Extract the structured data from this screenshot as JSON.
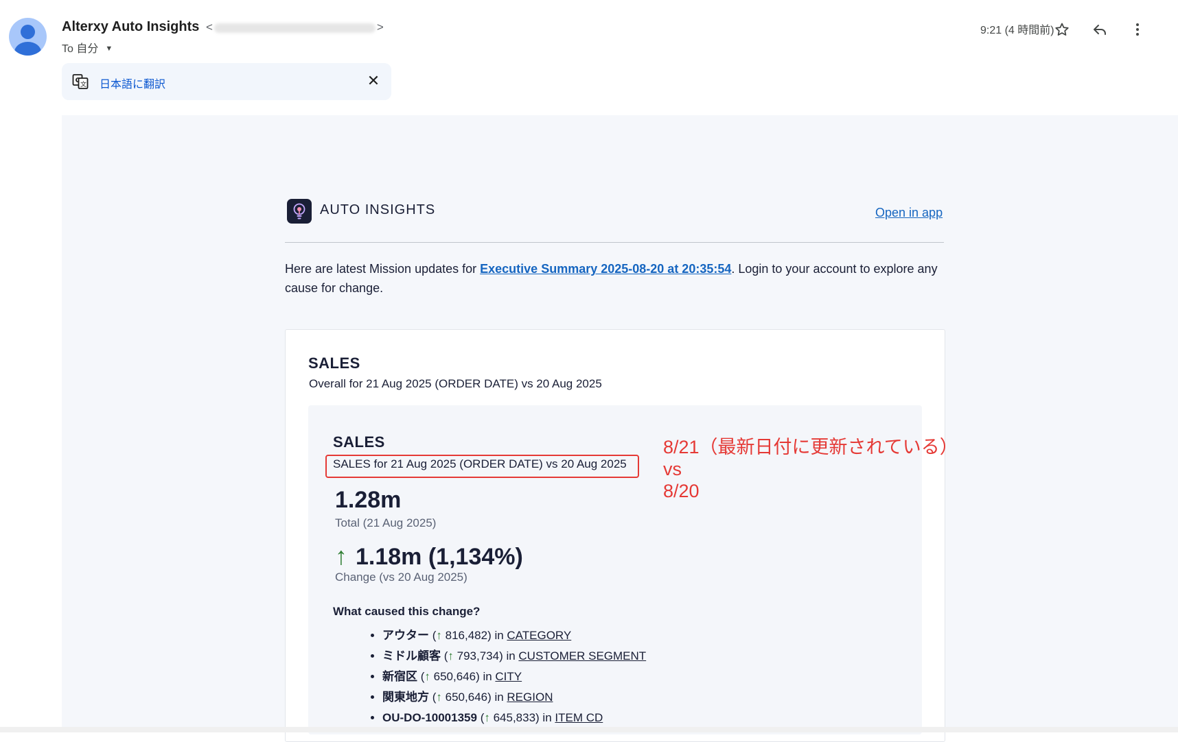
{
  "header": {
    "sender_name": "Alterxy Auto Insights",
    "sender_email_open": "<",
    "sender_email_close": ">",
    "to_label": "To 自分",
    "time": "9:21 (4 時間前)"
  },
  "translate_bar": {
    "link_label": "日本語に翻訳"
  },
  "email": {
    "brand": "AUTO INSIGHTS",
    "open_in_app": "Open in app",
    "intro_before": "Here are latest Mission updates for ",
    "intro_link": "Executive Summary 2025-08-20 at 20:35:54",
    "intro_after": ". Login to your account to explore any cause for change.",
    "card": {
      "title": "SALES",
      "subtitle": "Overall for 21 Aug 2025 (ORDER DATE) vs 20 Aug 2025",
      "inner": {
        "title": "SALES",
        "subtitle": "SALES for 21 Aug 2025 (ORDER DATE) vs 20 Aug 2025",
        "total_value": "1.28m",
        "total_caption": "Total (21 Aug 2025)",
        "change_arrow": "↑",
        "change_value": "1.18m (1,134%)",
        "change_caption": "Change (vs 20 Aug 2025)",
        "cause_question": "What caused this change?",
        "causes": [
          {
            "name": "アウター",
            "open": " (",
            "arrow": "↑",
            "value": " 816,482) in ",
            "dimension": "CATEGORY"
          },
          {
            "name": "ミドル顧客",
            "open": " (",
            "arrow": "↑",
            "value": " 793,734) in ",
            "dimension": "CUSTOMER SEGMENT"
          },
          {
            "name": "新宿区",
            "open": " (",
            "arrow": "↑",
            "value": " 650,646) in ",
            "dimension": "CITY"
          },
          {
            "name": "関東地方",
            "open": " (",
            "arrow": "↑",
            "value": " 650,646) in ",
            "dimension": "REGION"
          },
          {
            "name": "OU-DO-10001359",
            "open": " (",
            "arrow": "↑",
            "value": " 645,833) in ",
            "dimension": "ITEM CD"
          }
        ]
      }
    }
  },
  "annotation": {
    "line1": "8/21（最新日付に更新されている）",
    "line2": "vs",
    "line3": "8/20"
  },
  "colors": {
    "accent_link": "#1565c0",
    "up_arrow": "#2e7d32",
    "annotation_red": "#e53935"
  }
}
